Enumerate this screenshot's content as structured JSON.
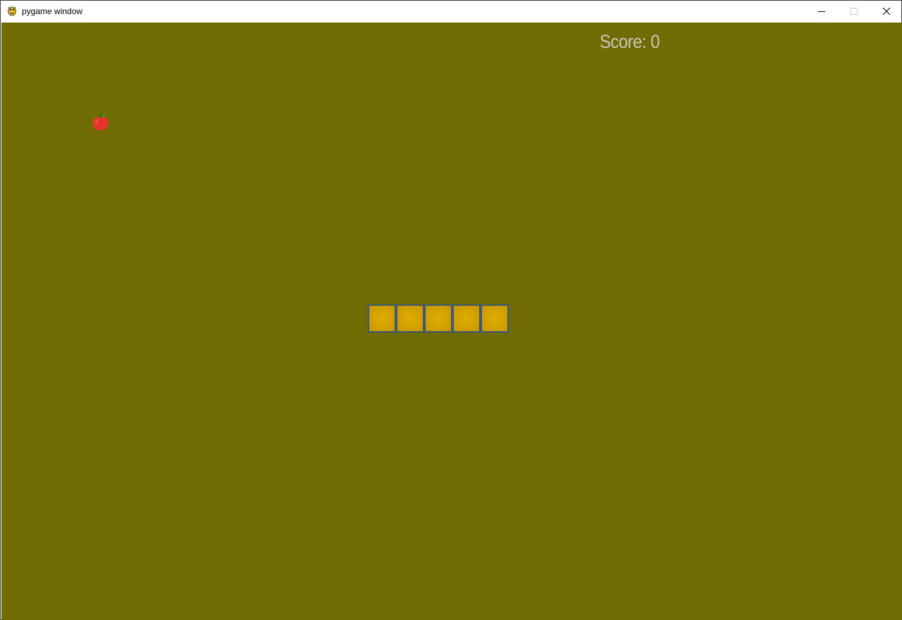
{
  "window": {
    "title": "pygame window",
    "app_icon": "pygame-snake-icon",
    "controls": {
      "minimize_icon": "minimize-icon",
      "maximize_icon": "maximize-icon",
      "close_icon": "close-icon"
    }
  },
  "game": {
    "background_color": "#6e6c02",
    "score_text": "Score: 0",
    "score_color": "#c9c7b6",
    "food": {
      "icon": "apple-icon",
      "color": "#e5342a"
    },
    "snake": {
      "segment_count": 5,
      "segment_fill": "#dba600",
      "segment_border": "#3d5878"
    }
  }
}
